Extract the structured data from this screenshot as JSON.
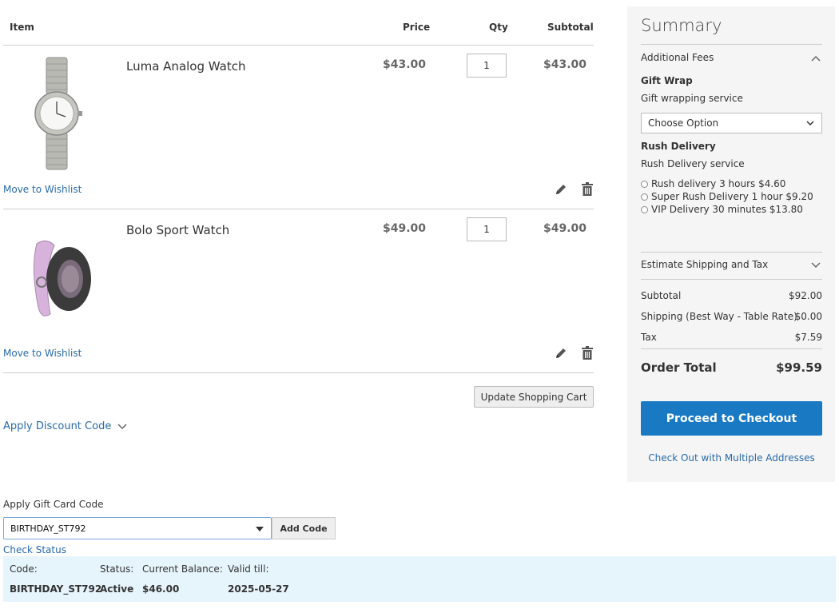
{
  "cart": {
    "headers": {
      "item": "Item",
      "price": "Price",
      "qty": "Qty",
      "subtotal": "Subtotal"
    },
    "items": [
      {
        "name": "Luma Analog Watch",
        "price": "$43.00",
        "qty": "1",
        "subtotal": "$43.00",
        "wishlist": "Move to Wishlist"
      },
      {
        "name": "Bolo Sport Watch",
        "price": "$49.00",
        "qty": "1",
        "subtotal": "$49.00",
        "wishlist": "Move to Wishlist"
      }
    ],
    "update_label": "Update Shopping Cart",
    "discount_label": "Apply Discount Code"
  },
  "gift_card": {
    "label": "Apply Gift Card Code",
    "value": "BIRTHDAY_ST792",
    "add_label": "Add Code",
    "check_status": "Check Status",
    "status": {
      "code_label": "Code:",
      "code_value": "BIRTHDAY_ST792",
      "status_label": "Status:",
      "status_value": "Active",
      "balance_label": "Current Balance:",
      "balance_value": "$46.00",
      "valid_label": "Valid till:",
      "valid_value": "2025-05-27"
    }
  },
  "summary": {
    "title": "Summary",
    "additional_fees": "Additional Fees",
    "gift_wrap_title": "Gift Wrap",
    "gift_wrap_sub": "Gift wrapping service",
    "gift_wrap_select": "Choose Option",
    "rush_title": "Rush Delivery",
    "rush_sub": "Rush Delivery service",
    "rush_options": [
      "Rush delivery 3 hours $4.60",
      "Super Rush Delivery 1 hour $9.20",
      "VIP Delivery 30 minutes $13.80"
    ],
    "estimate": "Estimate Shipping and Tax",
    "totals": {
      "subtotal_label": "Subtotal",
      "subtotal_value": "$92.00",
      "shipping_label": "Shipping (Best Way - Table Rate)",
      "shipping_value": "$0.00",
      "tax_label": "Tax",
      "tax_value": "$7.59"
    },
    "order_total_label": "Order Total",
    "order_total_value": "$99.59",
    "checkout_label": "Proceed to Checkout",
    "multi_label": "Check Out with Multiple Addresses"
  },
  "colors": {
    "link": "#2a6aa8",
    "primary": "#1979c3",
    "status_bg": "#e6f4fc",
    "summary_bg": "#f5f5f5"
  }
}
